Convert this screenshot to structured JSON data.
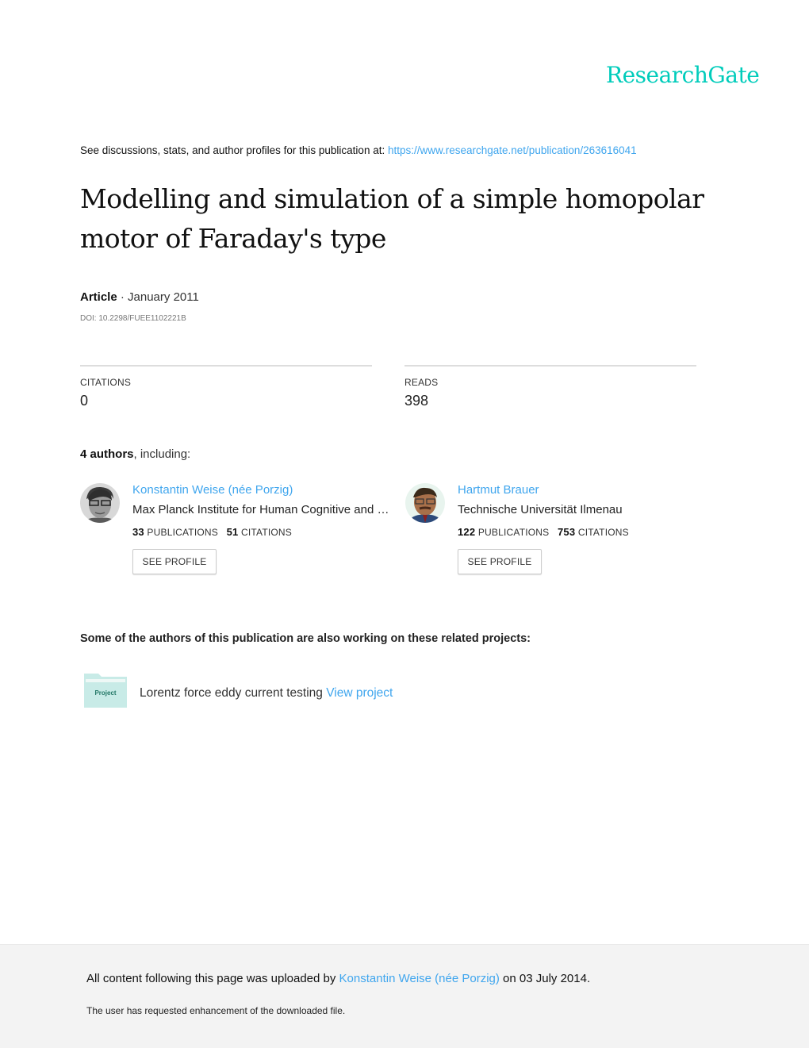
{
  "brand": {
    "logo_text": "ResearchGate",
    "color": "#00ccbb"
  },
  "header": {
    "see_text": "See discussions, stats, and author profiles for this publication at: ",
    "url": "https://www.researchgate.net/publication/263616041"
  },
  "publication": {
    "title": "Modelling and simulation of a simple homopolar motor of Faraday's type",
    "type": "Article",
    "date_separator": " · ",
    "date": "January 2011",
    "doi": "DOI: 10.2298/FUEE1102221B"
  },
  "stats": {
    "citations_label": "CITATIONS",
    "citations_value": "0",
    "reads_label": "READS",
    "reads_value": "398"
  },
  "authors_section": {
    "count_text": "4 authors",
    "suffix": ", including:"
  },
  "authors": [
    {
      "name": "Konstantin Weise (née Porzig)",
      "institution": "Max Planck Institute for Human Cognitive and …",
      "publications": "33",
      "publications_label": "PUBLICATIONS",
      "citations": "51",
      "citations_label": "CITATIONS",
      "button_label": "SEE PROFILE",
      "avatar": "avatar-photo"
    },
    {
      "name": "Hartmut Brauer",
      "institution": "Technische Universität Ilmenau",
      "publications": "122",
      "publications_label": "PUBLICATIONS",
      "citations": "753",
      "citations_label": "CITATIONS",
      "button_label": "SEE PROFILE",
      "avatar": "avatar-photo"
    }
  ],
  "projects_section": {
    "heading": "Some of the authors of this publication are also working on these related projects:",
    "projects": [
      {
        "icon_label": "Project",
        "name": "Lorentz force eddy current testing",
        "link_label": "View project"
      }
    ]
  },
  "footer": {
    "upload_prefix": "All content following this page was uploaded by ",
    "uploader": "Konstantin Weise (née Porzig)",
    "upload_suffix": " on 03 July 2014.",
    "note": "The user has requested enhancement of the downloaded file."
  },
  "colors": {
    "link": "#40a6ee",
    "footer_bg": "#f3f3f3",
    "folder": "#c8ebe7"
  }
}
